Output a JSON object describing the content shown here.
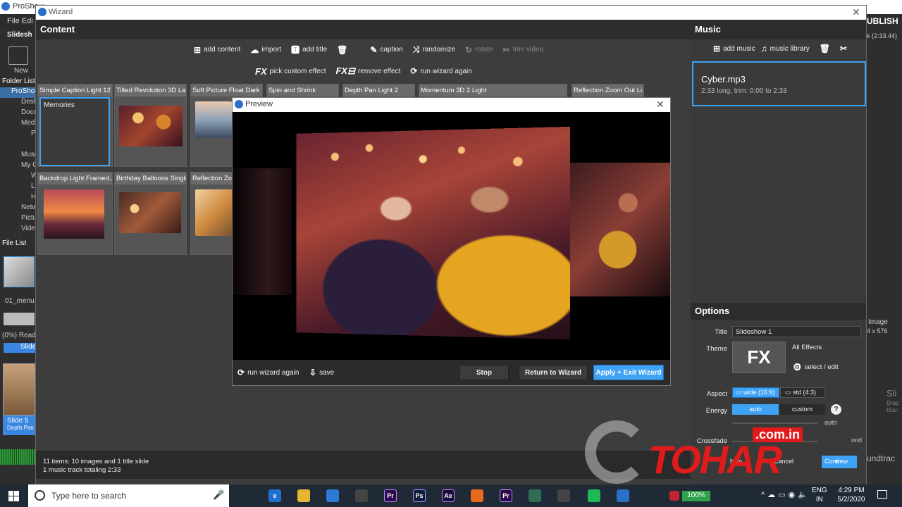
{
  "background_app": {
    "title": "ProShow",
    "menu": "File  Edi",
    "new_label": "New",
    "folder_list": "Folder List",
    "tree_items": [
      "ProSho",
      "Desk",
      "Docu",
      "Medi",
      "P",
      "Musi",
      "My C",
      "W",
      "L",
      "H",
      "Netw",
      "Pictu",
      "Vide"
    ],
    "slideshow_label": "Slidesh",
    "file_list": "File List",
    "file_name": "01_menu-",
    "ready_text": "(0%) Read",
    "slide_tab": "Slide",
    "slide5_label": "Slide 5",
    "slide5_sub": "Depth Pan",
    "right_publish": "UBLISH",
    "right_time": "k (2:33.44)",
    "right_image": "Image",
    "right_res": "4 x 576",
    "right_sli": "Sli",
    "right_drop": "Drop",
    "right_dou": "Dou",
    "right_soundtrack": "undtrac"
  },
  "wizard": {
    "title": "Wizard",
    "content": {
      "heading": "Content",
      "toolbar_row1": [
        {
          "icon": "add-icon",
          "label": "add content",
          "disabled": false
        },
        {
          "icon": "cloud-import-icon",
          "label": "import",
          "disabled": false
        },
        {
          "icon": "title-icon",
          "label": "add title",
          "disabled": false
        },
        {
          "icon": "trash-icon",
          "label": "",
          "disabled": false
        },
        {
          "icon": "pencil-icon",
          "label": "caption",
          "disabled": false
        },
        {
          "icon": "shuffle-icon",
          "label": "randomize",
          "disabled": false
        },
        {
          "icon": "rotate-icon",
          "label": "rotate",
          "disabled": true
        },
        {
          "icon": "tools-icon",
          "label": "trim video",
          "disabled": true
        }
      ],
      "toolbar_row2": [
        {
          "icon": "fx-icon",
          "label": "pick custom effect"
        },
        {
          "icon": "fx-remove-icon",
          "label": "remove effect"
        },
        {
          "icon": "refresh-icon",
          "label": "run wizard again"
        }
      ],
      "slides_row1": [
        "Simple Caption Light 12",
        "Tilted Revolution 3D La...",
        "Soft Picture Float Dark",
        "Spin and Shrink",
        "Depth Pan Light 2",
        "Momentum 3D 2 Light",
        "Reflection Zoom Out Li..."
      ],
      "slides_row2": [
        "Backdrop Light Framed...",
        "Birthday Balloons Single",
        "Reflection Zoo"
      ],
      "memories_text": "Memories",
      "status_line1": "11 items: 10 images and 1 title slide",
      "status_line2": "1 music track totaling 2:33"
    },
    "music": {
      "heading": "Music",
      "toolbar": [
        {
          "icon": "add-icon",
          "label": "add music"
        },
        {
          "icon": "music-note-icon",
          "label": "music library"
        },
        {
          "icon": "trash-icon",
          "label": ""
        },
        {
          "icon": "tools-icon",
          "label": ""
        }
      ],
      "track_name": "Cyber.mp3",
      "track_info": "2:33 long, trim: 0:00 to 2:33"
    },
    "options": {
      "heading": "Options",
      "title_label": "Title",
      "title_value": "Slideshow 1",
      "theme_label": "Theme",
      "theme_name": "All Effects",
      "theme_fx": "FX",
      "select_edit": "select / edit",
      "aspect_label": "Aspect",
      "aspect_wide": "wide (16:9)",
      "aspect_std": "std (4:3)",
      "energy_label": "Energy",
      "energy_auto": "auto",
      "energy_custom": "custom",
      "energy_slider_label": "auto",
      "crossfade_label": "Crossfade",
      "crossfade_value": "ond",
      "help_text": "help",
      "cancel_text": "Cancel",
      "continue_text": "Conti",
      "preview_text": "view"
    }
  },
  "preview": {
    "title": "Preview",
    "run_wizard_again": "run wizard again",
    "save": "save",
    "stop": "Stop",
    "return": "Return to Wizard",
    "apply_exit": "Apply + Exit Wizard"
  },
  "watermark": {
    "text": "TOHAR",
    "suffix": ".com.in"
  },
  "taskbar": {
    "search_placeholder": "Type here to search",
    "battery": "100%",
    "lang1": "ENG",
    "lang2": "IN",
    "time": "4:29 PM",
    "date": "5/2/2020",
    "apps": [
      {
        "name": "task-view-icon",
        "label": "",
        "color": "#1f2a36"
      },
      {
        "name": "edge-icon",
        "label": "e",
        "color": "#1f6fd0"
      },
      {
        "name": "file-explorer-icon",
        "label": "",
        "color": "#e8b530"
      },
      {
        "name": "mail-icon",
        "label": "",
        "color": "#2d7ad6"
      },
      {
        "name": "store-icon",
        "label": "",
        "color": "#444"
      },
      {
        "name": "premiere-icon",
        "label": "Pr",
        "color": "#2a0a4a"
      },
      {
        "name": "photoshop-icon",
        "label": "Ps",
        "color": "#0a1f3a"
      },
      {
        "name": "after-effects-icon",
        "label": "Ae",
        "color": "#1a0a3a"
      },
      {
        "name": "firefox-icon",
        "label": "",
        "color": "#e76b1e"
      },
      {
        "name": "premiere2-icon",
        "label": "Pr",
        "color": "#2a0a4a"
      },
      {
        "name": "app-green-icon",
        "label": "",
        "color": "#2f6e55"
      },
      {
        "name": "video-player-icon",
        "label": "",
        "color": "#444"
      },
      {
        "name": "spotify-icon",
        "label": "",
        "color": "#1db954"
      },
      {
        "name": "proshow-icon",
        "label": "",
        "color": "#2a6fc9"
      }
    ]
  },
  "colors": {
    "accent": "#3ea2f5",
    "panel": "#3a3a3a",
    "header": "#2d2d2d",
    "watermark": "#e01b1b"
  }
}
